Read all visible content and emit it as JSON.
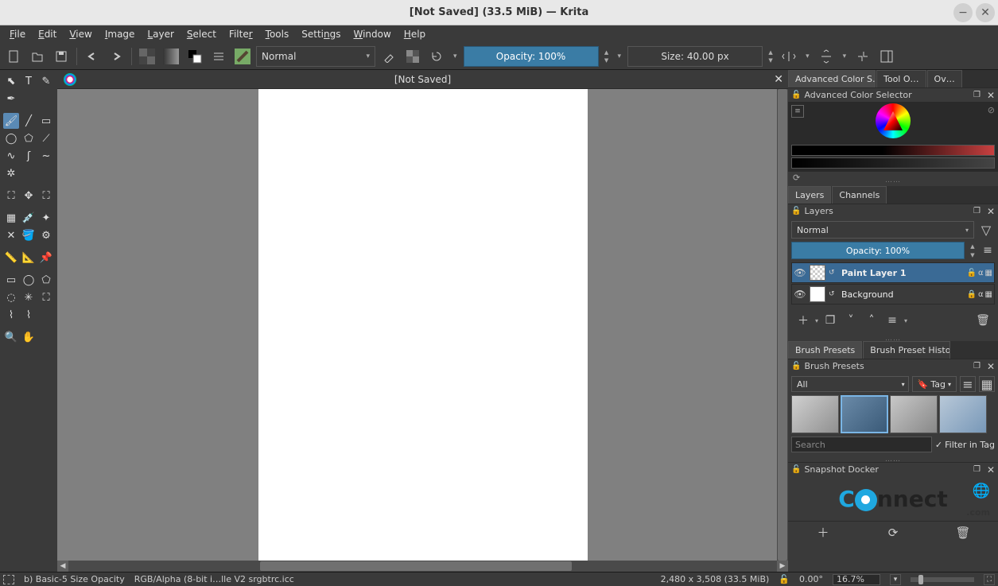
{
  "titlebar": {
    "title": "[Not Saved]  (33.5 MiB)  — Krita"
  },
  "menubar": {
    "file": "File",
    "edit": "Edit",
    "view": "View",
    "image": "Image",
    "layer": "Layer",
    "select": "Select",
    "filter": "Filter",
    "tools": "Tools",
    "settings": "Settings",
    "window": "Window",
    "help": "Help"
  },
  "toolbar": {
    "blend_mode": "Normal",
    "opacity_label": "Opacity: 100%",
    "size_label": "Size: 40.00 px"
  },
  "canvas": {
    "tab_title": "[Not Saved]"
  },
  "right_tabs": {
    "adv_color": "Advanced Color S…",
    "tool_options": "Tool O…",
    "overview": "Ov…"
  },
  "panel_headers": {
    "adv_color": "Advanced Color Selector",
    "layers": "Layers",
    "brush_presets": "Brush Presets",
    "snapshot": "Snapshot Docker"
  },
  "layers_tabs": {
    "layers": "Layers",
    "channels": "Channels"
  },
  "layers_panel": {
    "blend_mode": "Normal",
    "opacity_label": "Opacity:  100%",
    "items": [
      {
        "name": "Paint Layer 1",
        "selected": true,
        "checker": true,
        "locked": false
      },
      {
        "name": "Background",
        "selected": false,
        "checker": false,
        "locked": true
      }
    ]
  },
  "brush_tabs": {
    "presets": "Brush Presets",
    "history": "Brush Preset History"
  },
  "brush_panel": {
    "tag_filter": "All",
    "tag_button": "Tag",
    "search_placeholder": "Search",
    "filter_in_tag": "Filter in Tag"
  },
  "statusbar": {
    "brush": "b) Basic-5 Size Opacity",
    "colorspace": "RGB/Alpha (8-bit i…lle V2 srgbtrc.icc",
    "dimensions": "2,480 x 3,508 (33.5 MiB)",
    "rotation": "0.00°",
    "zoom": "16.7%"
  }
}
